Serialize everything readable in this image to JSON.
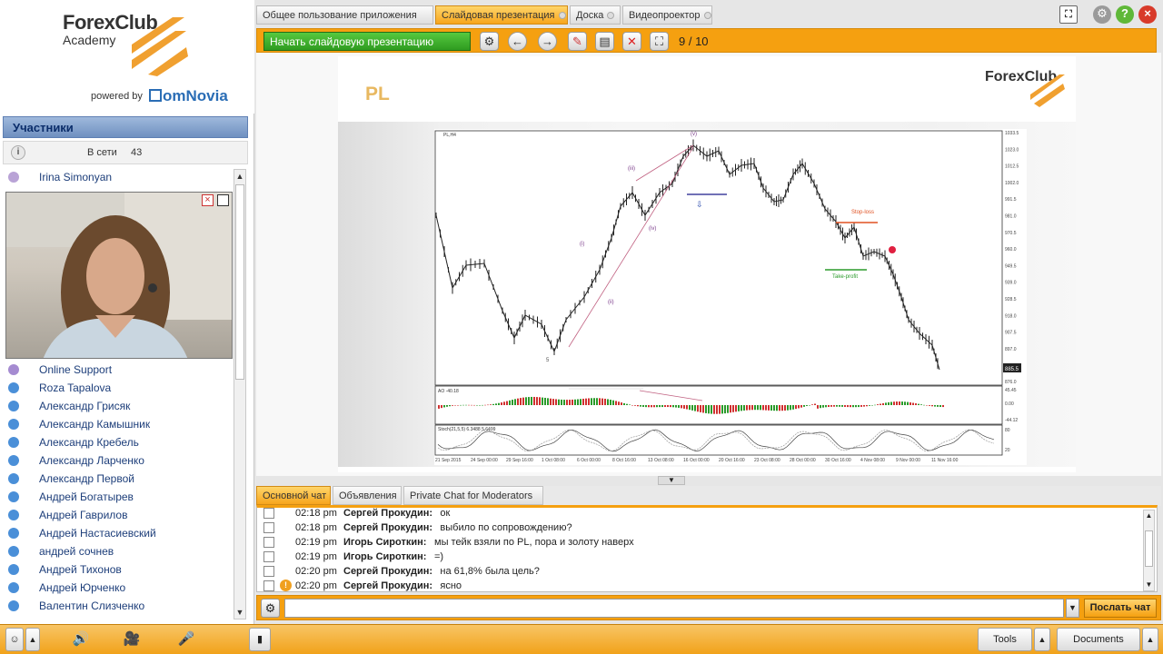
{
  "brand": {
    "name": "ForexClub",
    "sub": "Academy",
    "powered_by": "powered by",
    "omnovia": "omNovia"
  },
  "participants": {
    "title": "Участники",
    "online_label": "В сети",
    "online_count": "43",
    "presenter": "Irina Simonyan",
    "list": [
      "Online Support",
      "Roza Tapalova",
      "Александр Грисяк",
      "Александр Камышник",
      "Александр Кребель",
      "Александр Ларченко",
      "Александр Первой",
      "Андрей Богатырев",
      "Андрей Гаврилов",
      "Андрей Настасиевский",
      "андрей сочнев",
      "Андрей Тихонов",
      "Андрей Юрченко",
      "Валентин Слизченко"
    ]
  },
  "tabs": [
    "Общее пользование приложения",
    "Слайдовая презентация",
    "Доска",
    "Видеопроектор"
  ],
  "toolbar": {
    "start_label": "Начать слайдовую презентацию",
    "page": "9 / 10"
  },
  "slide": {
    "title": "PL",
    "brand": "ForexClub",
    "chart_title": "PL,H4",
    "wave_labels": [
      "(v)",
      "(iii)",
      "(i)",
      "(iv)",
      "(ii)",
      "5"
    ],
    "annotations": {
      "stop_loss": "Stop-loss",
      "take_profit": "Take-profit"
    },
    "y_ticks": [
      "1033.5",
      "1023.0",
      "1012.5",
      "1002.0",
      "991.5",
      "981.0",
      "970.5",
      "960.0",
      "949.5",
      "939.0",
      "928.5",
      "918.0",
      "907.5",
      "897.0",
      "876.0"
    ],
    "price_tag": "885.5",
    "x_ticks": [
      "21 Sep 2015",
      "24 Sep 00:00",
      "29 Sep 16:00",
      "1 Oct 08:00",
      "6 Oct 00:00",
      "8 Oct 16:00",
      "13 Oct 08:00",
      "16 Oct 00:00",
      "20 Oct 16:00",
      "23 Oct 08:00",
      "28 Oct 00:00",
      "30 Oct 16:00",
      "4 Nov 08:00",
      "9 Nov 00:00",
      "11 Nov 16:00"
    ],
    "ao_label": "AO -40.18",
    "ao_ticks": [
      "45.45",
      "0.00",
      "-44.12"
    ],
    "stoch_label": "Stoch(21,5,5) 6.3488 5.6499",
    "stoch_ticks": [
      "80",
      "20"
    ]
  },
  "chat": {
    "tabs": [
      "Основной чат",
      "Объявления",
      "Private Chat for Moderators"
    ],
    "messages": [
      {
        "time": "02:18 pm",
        "who": "Сергей Прокудин:",
        "text": "ок"
      },
      {
        "time": "02:18 pm",
        "who": "Сергей Прокудин:",
        "text": "выбило по сопровождению?"
      },
      {
        "time": "02:19 pm",
        "who": "Игорь Сироткин:",
        "text": "мы тейк взяли по PL, пора и золоту наверх"
      },
      {
        "time": "02:19 pm",
        "who": "Игорь Сироткин:",
        "text": "=)"
      },
      {
        "time": "02:20 pm",
        "who": "Сергей Прокудин:",
        "text": "на 61,8% была цель?"
      },
      {
        "time": "02:20 pm",
        "who": "Сергей Прокудин:",
        "text": "ясно"
      }
    ],
    "send_label": "Послать чат"
  },
  "bottom": {
    "tools": "Tools",
    "documents": "Documents"
  },
  "colors": {
    "accent": "#f5a010",
    "green": "#2f9b20",
    "blue_head": "#6f90c0"
  }
}
